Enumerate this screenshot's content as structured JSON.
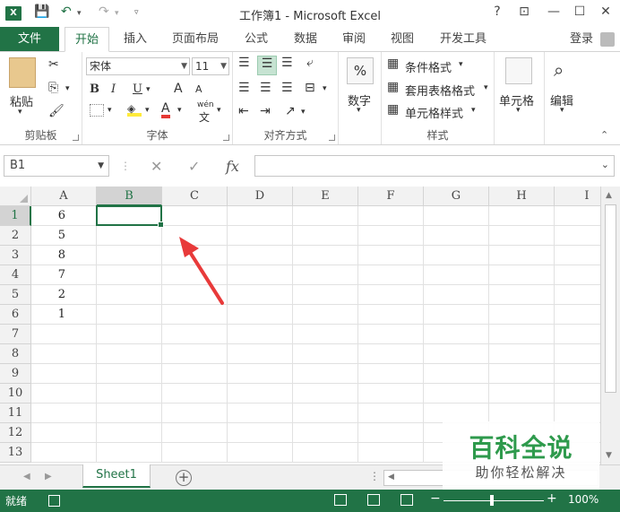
{
  "titlebar": {
    "title": "工作簿1 - Microsoft Excel",
    "logo": "X",
    "help": "?",
    "ribbon_display": "⊡",
    "minimize": "—",
    "maximize": "☐",
    "close": "✕",
    "save_icon": "floppy-icon",
    "undo_icon": "undo-icon",
    "redo_icon": "redo-icon"
  },
  "tabs": {
    "file": "文件",
    "items": [
      "开始",
      "插入",
      "页面布局",
      "公式",
      "数据",
      "审阅",
      "视图",
      "开发工具"
    ],
    "active": "开始",
    "login": "登录"
  },
  "ribbon": {
    "clipboard": {
      "label": "剪贴板",
      "paste": "粘贴"
    },
    "font": {
      "label": "字体",
      "name": "宋体",
      "size": "11",
      "bold": "B",
      "italic": "I",
      "underline": "U",
      "grow": "A",
      "shrink": "A",
      "font_color": "A",
      "phonetic": "wén"
    },
    "alignment": {
      "label": "对齐方式"
    },
    "number": {
      "label": "数字",
      "percent": "%"
    },
    "styles": {
      "label": "样式",
      "conditional": "条件格式",
      "table": "套用表格格式",
      "cell_styles": "单元格样式"
    },
    "cells": {
      "label": "单元格"
    },
    "editing": {
      "label": "编辑"
    }
  },
  "formulabar": {
    "namebox": "B1",
    "cancel": "✕",
    "enter": "✓",
    "fx": "fx",
    "formula": ""
  },
  "grid": {
    "columns": [
      "A",
      "B",
      "C",
      "D",
      "E",
      "F",
      "G",
      "H",
      "I"
    ],
    "selected_column": "B",
    "rows": [
      "1",
      "2",
      "3",
      "4",
      "5",
      "6",
      "7",
      "8",
      "9",
      "10",
      "11",
      "12",
      "13"
    ],
    "selected_row": "1",
    "col_a_values": [
      "6",
      "5",
      "8",
      "7",
      "2",
      "1"
    ]
  },
  "sheets": {
    "tabs": [
      "Sheet1"
    ],
    "add": "+"
  },
  "statusbar": {
    "ready": "就绪",
    "zoom": "100%",
    "minus": "−",
    "plus": "+"
  },
  "watermark": {
    "main": "百科全说",
    "sub": "助你轻松解决"
  },
  "colors": {
    "accent": "#217346",
    "arrow": "#e83a3a"
  }
}
